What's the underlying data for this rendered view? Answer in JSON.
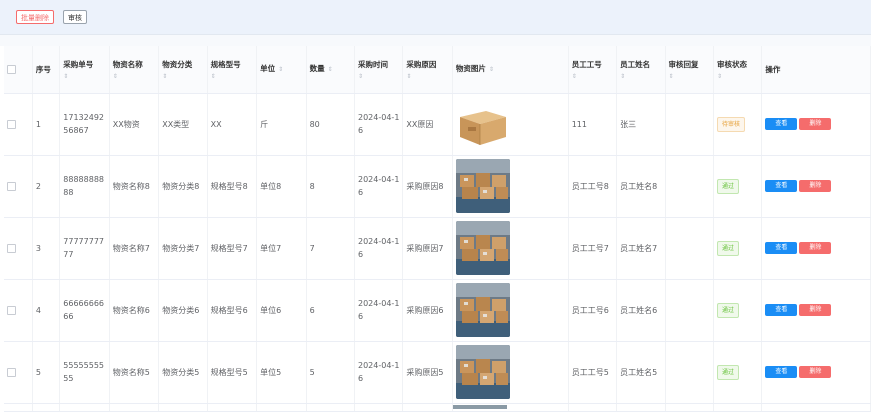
{
  "toolbar": {
    "batch_delete_label": "批量删除",
    "audit_label": "审核"
  },
  "table": {
    "headers": {
      "index": "序号",
      "order_no": "采购单号",
      "name": "物资名称",
      "category": "物资分类",
      "spec": "规格型号",
      "unit": "单位",
      "qty": "数量",
      "time": "采购时间",
      "reason": "采购原因",
      "image": "物资图片",
      "emp_no": "员工工号",
      "emp_name": "员工姓名",
      "reply": "审核回复",
      "status": "审核状态",
      "ops": "操作"
    },
    "sort_icon": "⇕",
    "view_label": "查看",
    "delete_label": "删除",
    "rows": [
      {
        "index": "1",
        "order_no": "1713249256867",
        "name": "XX物资",
        "category": "XX类型",
        "spec": "XX",
        "unit": "斤",
        "qty": "80",
        "time": "2024-04-16",
        "reason": "XX原因",
        "image": "carton-box",
        "emp_no": "111",
        "emp_name": "张三",
        "reply": "",
        "status": "待审核",
        "status_type": "pending"
      },
      {
        "index": "2",
        "order_no": "8888888888",
        "name": "物资名称8",
        "category": "物资分类8",
        "spec": "规格型号8",
        "unit": "单位8",
        "qty": "8",
        "time": "2024-04-16",
        "reason": "采购原因8",
        "image": "warehouse-photo",
        "emp_no": "员工工号8",
        "emp_name": "员工姓名8",
        "reply": "",
        "status": "通过",
        "status_type": "passed"
      },
      {
        "index": "3",
        "order_no": "7777777777",
        "name": "物资名称7",
        "category": "物资分类7",
        "spec": "规格型号7",
        "unit": "单位7",
        "qty": "7",
        "time": "2024-04-16",
        "reason": "采购原因7",
        "image": "warehouse-photo",
        "emp_no": "员工工号7",
        "emp_name": "员工姓名7",
        "reply": "",
        "status": "通过",
        "status_type": "passed"
      },
      {
        "index": "4",
        "order_no": "6666666666",
        "name": "物资名称6",
        "category": "物资分类6",
        "spec": "规格型号6",
        "unit": "单位6",
        "qty": "6",
        "time": "2024-04-16",
        "reason": "采购原因6",
        "image": "warehouse-photo",
        "emp_no": "员工工号6",
        "emp_name": "员工姓名6",
        "reply": "",
        "status": "通过",
        "status_type": "passed"
      },
      {
        "index": "5",
        "order_no": "5555555555",
        "name": "物资名称5",
        "category": "物资分类5",
        "spec": "规格型号5",
        "unit": "单位5",
        "qty": "5",
        "time": "2024-04-16",
        "reason": "采购原因5",
        "image": "warehouse-photo",
        "emp_no": "员工工号5",
        "emp_name": "员工姓名5",
        "reply": "",
        "status": "通过",
        "status_type": "passed"
      }
    ]
  },
  "colors": {
    "accent": "#1a8df5",
    "danger": "#f56c6c",
    "pending": "#e6a23c",
    "success": "#67c23a",
    "toolbar_bg": "#ecf2fb"
  }
}
